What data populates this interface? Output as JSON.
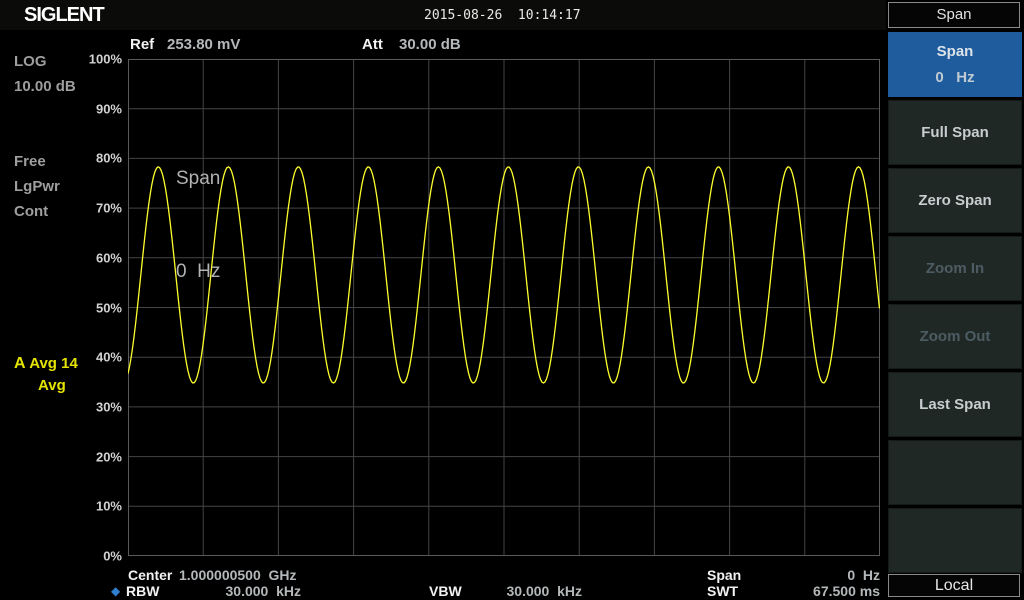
{
  "header": {
    "brand": "SIGLENT",
    "datetime": "2015-08-26  10:14:17"
  },
  "trace_header": {
    "ref_label": "Ref",
    "ref_value": "253.80 mV",
    "att_label": "Att",
    "att_value": "30.00 dB"
  },
  "left_panel": {
    "scale_type": "LOG",
    "scale_value": "10.00 dB",
    "trigger": "Free",
    "power_mode": "LgPwr",
    "sweep_mode": "Cont",
    "trace": {
      "letter": "A",
      "label": "Avg 14",
      "sub_label": "Avg"
    }
  },
  "plot": {
    "annotation_line1": "Span",
    "annotation_line2": "0  Hz",
    "y_tick_labels": [
      "100%",
      "90%",
      "80%",
      "70%",
      "60%",
      "50%",
      "40%",
      "30%",
      "20%",
      "10%",
      "0%"
    ]
  },
  "footer": {
    "center_label": "Center",
    "center_value": "1.000000500  GHz",
    "span_label": "Span",
    "span_value": "0  Hz",
    "rbw_marker": "◆",
    "rbw_label": "RBW",
    "rbw_value": "30.000  kHz",
    "vbw_label": "VBW",
    "vbw_value": "30.000  kHz",
    "swt_label": "SWT",
    "swt_value": "67.500 ms"
  },
  "menu": {
    "title": "Span",
    "buttons": [
      {
        "label": "Span",
        "value": "0   Hz",
        "selected": true,
        "enabled": true
      },
      {
        "label": "Full Span",
        "selected": false,
        "enabled": true
      },
      {
        "label": "Zero Span",
        "selected": false,
        "enabled": true
      },
      {
        "label": "Zoom In",
        "selected": false,
        "enabled": false
      },
      {
        "label": "Zoom Out",
        "selected": false,
        "enabled": false
      },
      {
        "label": "Last Span",
        "selected": false,
        "enabled": true
      },
      {
        "label": "",
        "selected": false,
        "enabled": true
      },
      {
        "label": "",
        "selected": false,
        "enabled": true
      }
    ],
    "local_label": "Local"
  },
  "colors": {
    "trace": "#ffff2e",
    "grid": "#454545",
    "frame": "#5a5a5a",
    "selected_button": "#1e5c9e",
    "rbw_marker_blue": "#2f7fd0",
    "status_yellow": "#e4e400"
  },
  "chart_data": {
    "type": "line",
    "grid": true,
    "ylim": [
      0,
      100
    ],
    "y_tick_step_pct": 10,
    "x_readouts": {
      "center": "1.000000500 GHz",
      "span": "0 Hz",
      "rbw": "30.000 kHz",
      "vbw": "30.000 kHz",
      "sweep_time": "67.500 ms",
      "reference": "253.80 mV",
      "attenuation": "30.00 dB"
    },
    "series": [
      {
        "name": "Trace A (Avg 14)",
        "waveform": "sine",
        "peak_pct": 78.3,
        "trough_pct": 34.8,
        "cycles_visible": 10.74,
        "first_peak_x_fraction": 0.0403
      }
    ]
  }
}
